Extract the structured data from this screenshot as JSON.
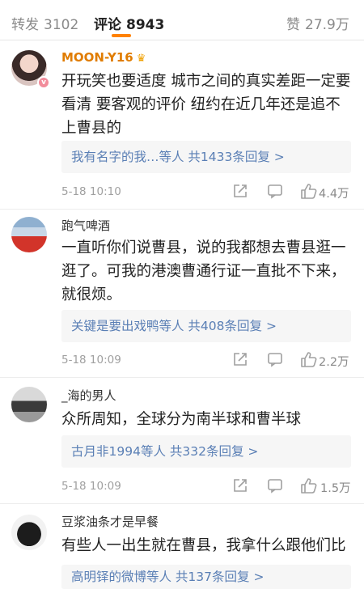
{
  "tabs": {
    "repost": {
      "label": "转发",
      "count": "3102"
    },
    "comments": {
      "label": "评论",
      "count": "8943"
    },
    "likes": {
      "label": "赞",
      "count": "27.9万"
    }
  },
  "comments": [
    {
      "username": "MOON-Y16",
      "text": "开玩笑也要适度 城市之间的真实差距一定要看清 要客观的评价 纽约在近几年还是追不上曹县的",
      "replies": "我有名字的我…等人 共1433条回复 >",
      "time": "5-18 10:10",
      "likes": "4.4万"
    },
    {
      "username": "跑气啤酒",
      "text": "一直听你们说曹县，说的我都想去曹县逛一逛了。可我的港澳曹通行证一直批不下来，就很烦。",
      "replies": "关键是要出戏鸭等人 共408条回复 >",
      "time": "5-18 10:09",
      "likes": "2.2万"
    },
    {
      "username": "_海的男人",
      "text": "众所周知，全球分为南半球和曹半球",
      "replies": "古月非1994等人 共332条回复 >",
      "time": "5-18 10:09",
      "likes": "1.5万"
    },
    {
      "username": "豆浆油条才是早餐",
      "text": "有些人一出生就在曹县，我拿什么跟他们比",
      "replies": "高明铎的微博等人 共137条回复 >"
    }
  ],
  "colors": {
    "accent": "#ff8200",
    "link": "#5a7fb5",
    "vip": "#e07c00"
  }
}
